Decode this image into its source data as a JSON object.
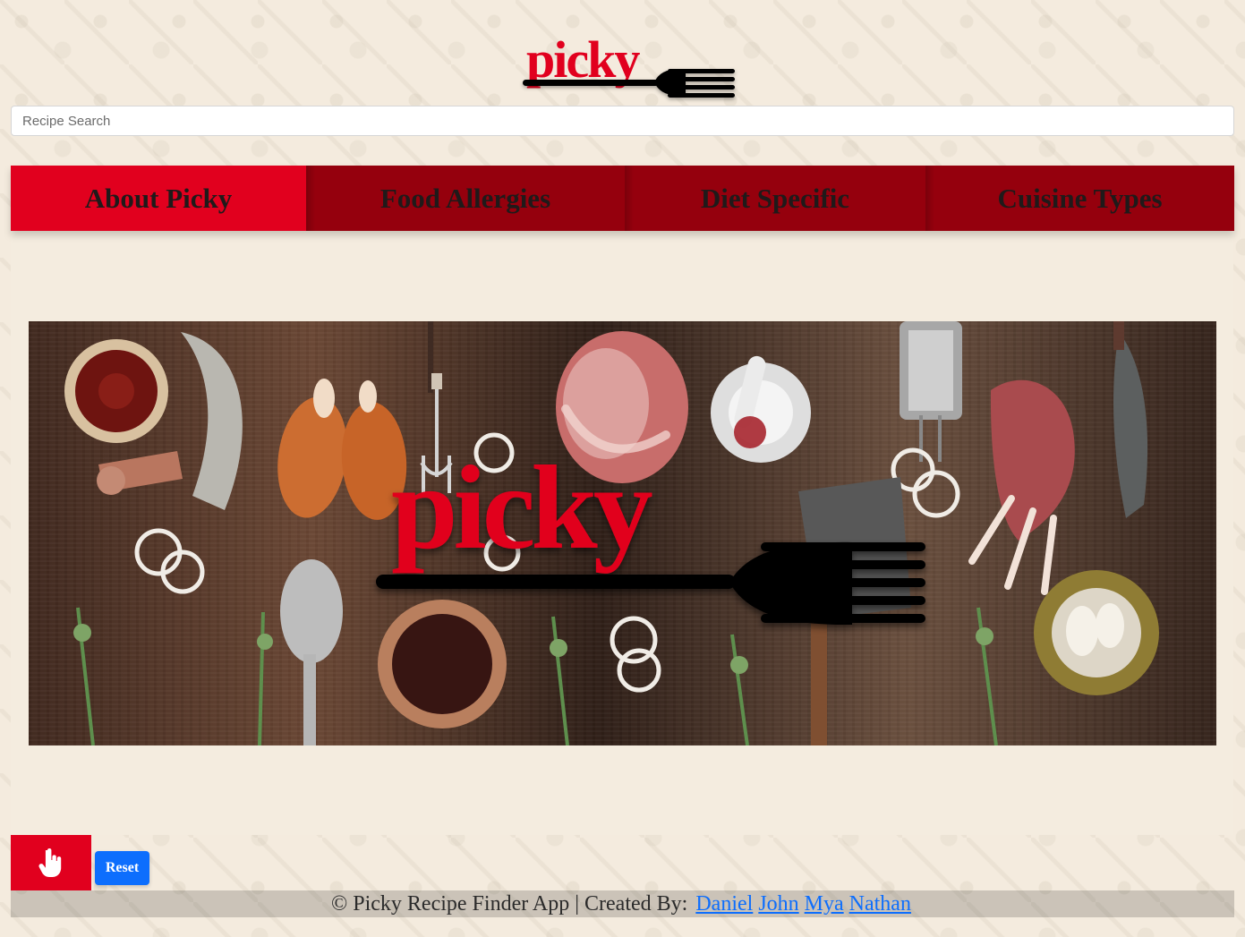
{
  "header": {
    "logo_text": "picky",
    "search_placeholder": "Recipe Search"
  },
  "nav": {
    "items": [
      {
        "label": "About Picky",
        "active": true
      },
      {
        "label": "Food Allergies",
        "active": false
      },
      {
        "label": "Diet Specific",
        "active": false
      },
      {
        "label": "Cuisine Types",
        "active": false
      }
    ]
  },
  "hero": {
    "logo_text": "picky",
    "decorative_icons": [
      "fork-icon",
      "knife-icon",
      "bowl-icon",
      "herb-icon",
      "onion-ring-icon",
      "meat-icon"
    ]
  },
  "controls": {
    "hand_icon": "hand-pointer-icon",
    "reset_label": "Reset"
  },
  "footer": {
    "text": "© Picky Recipe Finder App | Created By:",
    "links": [
      {
        "label": "Daniel"
      },
      {
        "label": "John"
      },
      {
        "label": "Mya"
      },
      {
        "label": "Nathan"
      }
    ]
  },
  "colors": {
    "page_background": "#f4ebde",
    "nav_active": "#e1001e",
    "nav_inactive": "#95000d",
    "link_blue": "#0d6efd",
    "brand_red": "#e1001e"
  }
}
